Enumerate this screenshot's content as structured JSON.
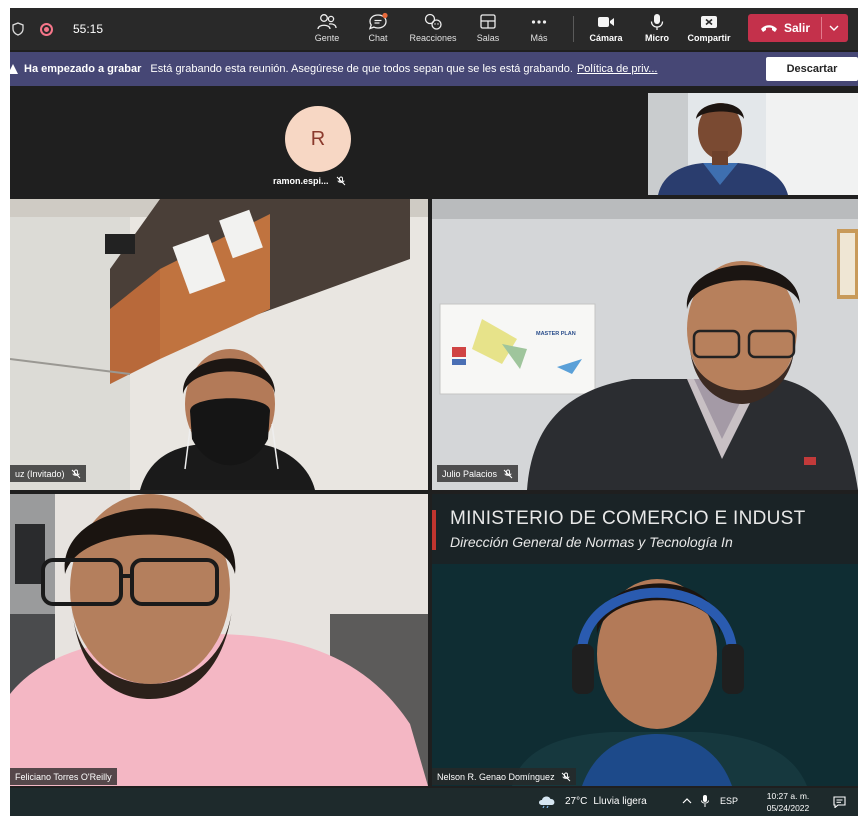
{
  "colors": {
    "toolbar_bg": "#292929",
    "banner_bg": "#464775",
    "leave_button": "#c4314b",
    "recording_indicator": "#f6768a",
    "avatar_bg": "#f7d7c4",
    "taskbar_bg": "#1e2a2c"
  },
  "toolbar": {
    "timer": "55:15",
    "buttons": [
      {
        "label": "Gente",
        "icon": "people-icon"
      },
      {
        "label": "Chat",
        "icon": "chat-icon"
      },
      {
        "label": "Reacciones",
        "icon": "reactions-icon"
      },
      {
        "label": "Salas",
        "icon": "rooms-icon"
      },
      {
        "label": "Más",
        "icon": "more-icon"
      },
      {
        "label": "Cámara",
        "icon": "camera-icon"
      },
      {
        "label": "Micro",
        "icon": "microphone-icon"
      },
      {
        "label": "Compartir",
        "icon": "share-icon"
      }
    ],
    "leave_label": "Salir"
  },
  "banner": {
    "title": "Ha empezado a grabar",
    "message": "Está grabando esta reunión. Asegúrese de que todos sepan que se les está grabando.",
    "link": "Política de priv...",
    "dismiss_label": "Descartar"
  },
  "audio_participant": {
    "initial": "R",
    "name": "ramon.espi..."
  },
  "participants": [
    {
      "name": "uz (Invitado)",
      "muted": true
    },
    {
      "name": "Julio Palacios",
      "muted": true
    },
    {
      "name": "Feliciano Torres O'Reilly",
      "muted": false
    },
    {
      "name": "Nelson R. Genao Domínguez",
      "muted": true
    }
  ],
  "background_text": {
    "heading": "MINISTERIO DE COMERCIO E INDUST",
    "subheading": "Dirección General de Normas y Tecnología In"
  },
  "poster": {
    "title": "MASTER PLAN"
  },
  "taskbar": {
    "temperature": "27°C",
    "condition": "Lluvia ligera",
    "language": "ESP",
    "time": "10:27 a. m.",
    "date": "05/24/2022"
  }
}
